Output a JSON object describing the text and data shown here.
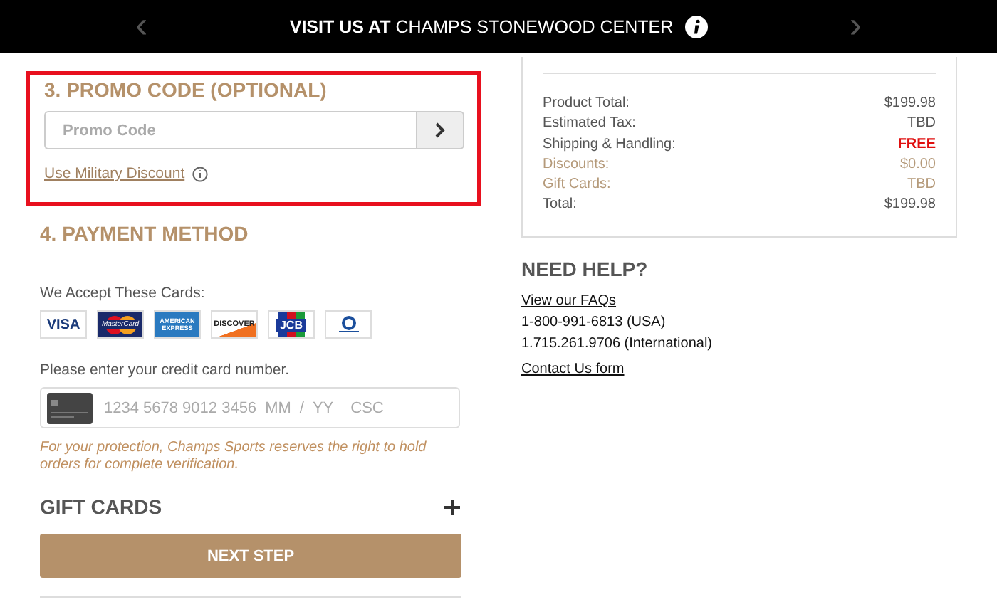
{
  "banner": {
    "prefix": "VISIT US AT",
    "store": "CHAMPS STONEWOOD CENTER",
    "prev": "‹",
    "next": "›"
  },
  "promo": {
    "title": "3. PROMO CODE (OPTIONAL)",
    "highlighted": true,
    "placeholder": "Promo Code",
    "military_link": "Use Military Discount"
  },
  "payment": {
    "title": "4. PAYMENT METHOD",
    "accept_label": "We Accept These Cards:",
    "cards": [
      {
        "kind": "visa",
        "label": "VISA"
      },
      {
        "kind": "mastercard",
        "label": "MasterCard"
      },
      {
        "kind": "amex",
        "label": "AMERICAN EXPRESS"
      },
      {
        "kind": "discover",
        "label": "DISCOVER"
      },
      {
        "kind": "jcb",
        "label": "JCB"
      },
      {
        "kind": "diners"
      }
    ],
    "card_prompt": "Please enter your credit card number.",
    "card_field": {
      "number_placeholder": "1234 5678 9012 3456",
      "month_placeholder": "MM",
      "separator": "/",
      "year_placeholder": "YY",
      "csc_placeholder": "CSC"
    },
    "notice": "For your protection, Champs Sports reserves the right to hold orders for complete verification."
  },
  "gift_cards": {
    "title": "GIFT CARDS",
    "expanded": false
  },
  "next_button": "NEXT STEP",
  "summary": {
    "rows": [
      {
        "label": "Product Total:",
        "value": "$199.98",
        "kind": "normal"
      },
      {
        "label": "Estimated Tax:",
        "value": "TBD",
        "kind": "normal"
      },
      {
        "label": "Shipping & Handling:",
        "value": "FREE",
        "kind": "free"
      },
      {
        "label": "Discounts:",
        "value": "$0.00",
        "kind": "muted"
      },
      {
        "label": "Gift Cards:",
        "value": "TBD",
        "kind": "muted"
      },
      {
        "label": "Total:",
        "value": "$199.98",
        "kind": "normal"
      }
    ]
  },
  "help": {
    "title": "NEED HELP?",
    "lines": [
      {
        "text": "View our FAQs",
        "kind": "link"
      },
      {
        "text": "1-800-991-6813 (USA)",
        "kind": "text"
      },
      {
        "text": "1.715.261.9706 (International)",
        "kind": "text"
      },
      {
        "text": "Contact Us form",
        "kind": "link"
      }
    ]
  }
}
